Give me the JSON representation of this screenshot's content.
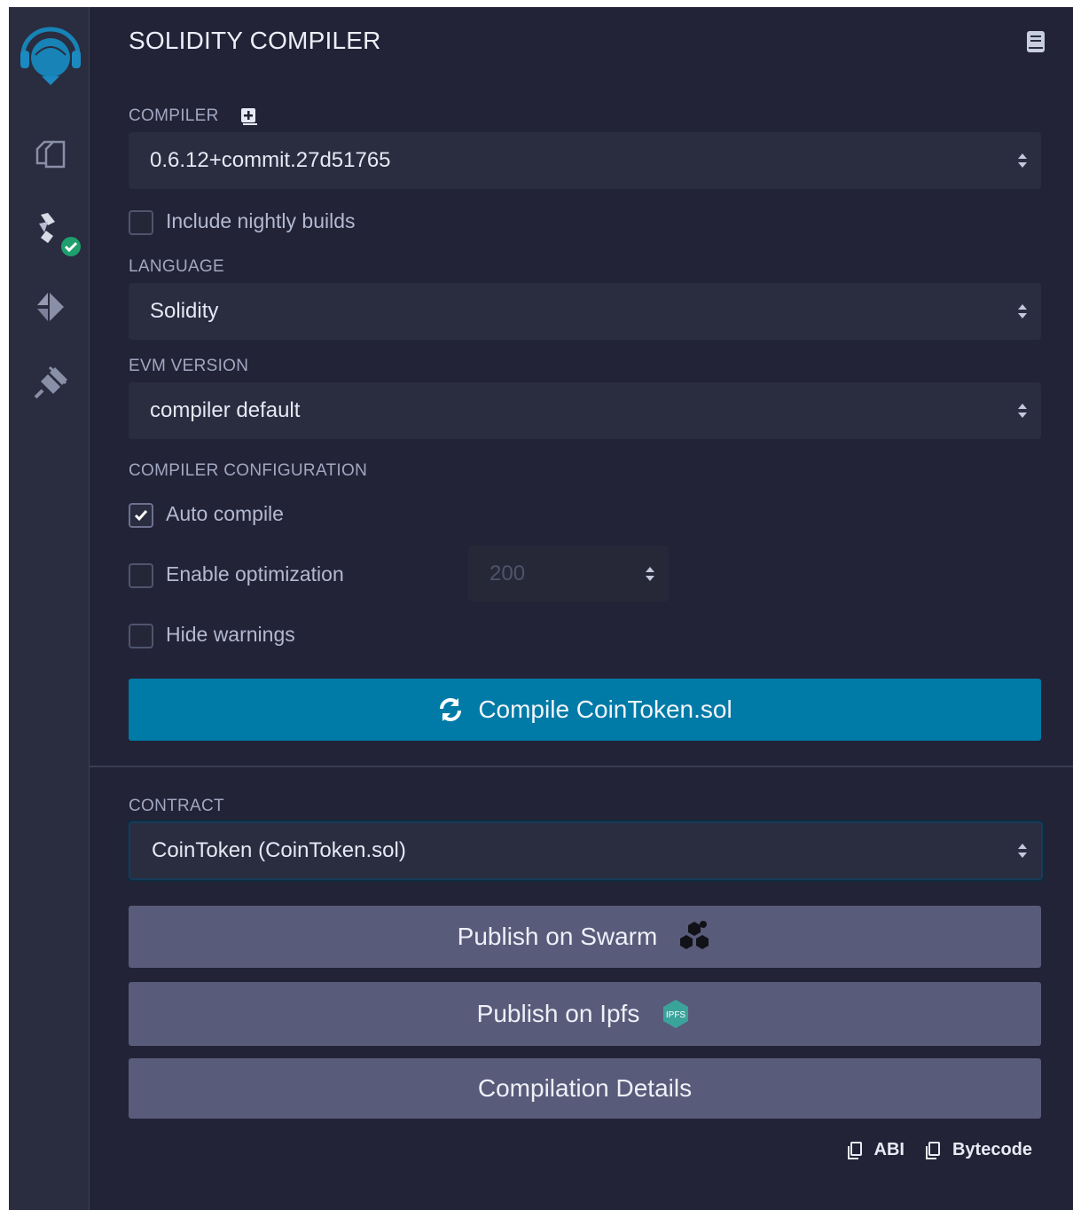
{
  "panel": {
    "title": "SOLIDITY COMPILER"
  },
  "compiler": {
    "label": "COMPILER",
    "version": "0.6.12+commit.27d51765",
    "nightly_label": "Include nightly builds",
    "nightly_checked": false
  },
  "language": {
    "label": "LANGUAGE",
    "value": "Solidity"
  },
  "evm": {
    "label": "EVM VERSION",
    "value": "compiler default"
  },
  "config": {
    "label": "COMPILER CONFIGURATION",
    "auto_compile_label": "Auto compile",
    "auto_compile_checked": true,
    "optimization_label": "Enable optimization",
    "optimization_checked": false,
    "optimization_runs": "200",
    "hide_warnings_label": "Hide warnings",
    "hide_warnings_checked": false
  },
  "compile_button": "Compile CoinToken.sol",
  "contract": {
    "label": "CONTRACT",
    "value": "CoinToken (CoinToken.sol)"
  },
  "actions": {
    "publish_swarm": "Publish on Swarm",
    "publish_ipfs": "Publish on Ipfs",
    "ipfs_badge": "IPFS",
    "compilation_details": "Compilation Details"
  },
  "copy": {
    "abi": "ABI",
    "bytecode": "Bytecode"
  },
  "icons": {
    "logo": "remix-logo-icon",
    "file_explorer": "files-icon",
    "compiler": "solidity-compiler-icon",
    "deploy": "ethereum-deploy-icon",
    "plugins": "plug-icon",
    "docs": "book-icon"
  },
  "colors": {
    "background": "#222336",
    "rail": "#2a2c3f",
    "primary": "#007aa6",
    "secondary": "#595b7a",
    "success": "#1f9e6e"
  }
}
